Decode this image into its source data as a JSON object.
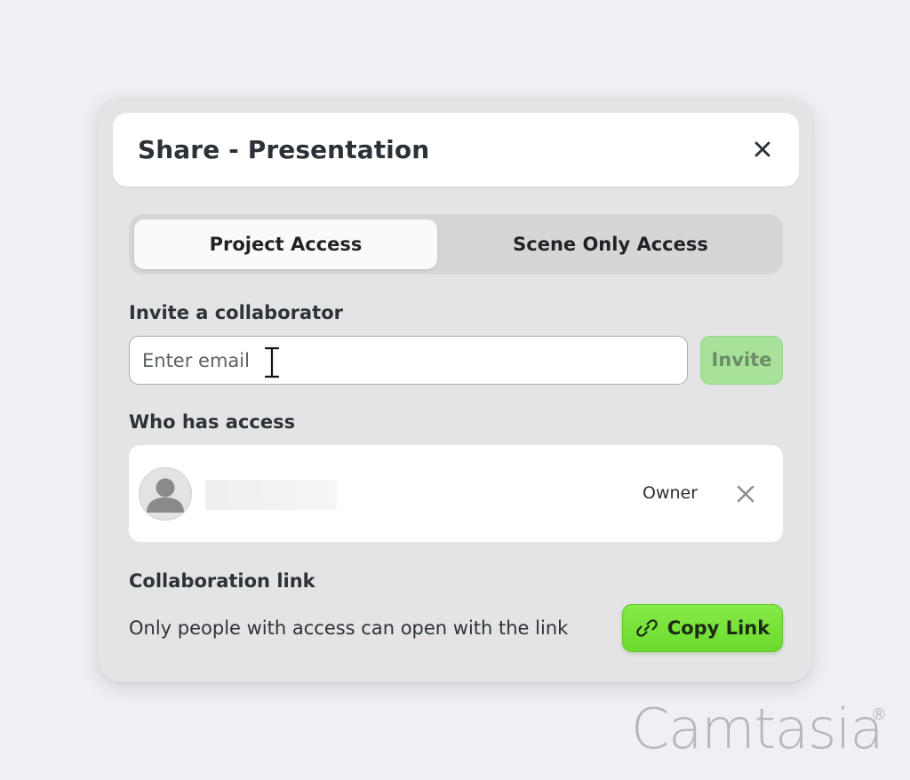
{
  "dialog": {
    "title": "Share - Presentation"
  },
  "tabs": [
    {
      "label": "Project Access",
      "active": true
    },
    {
      "label": "Scene Only Access",
      "active": false
    }
  ],
  "invite": {
    "section_label": "Invite a collaborator",
    "placeholder": "Enter email",
    "value": "",
    "button_label": "Invite",
    "button_enabled": false
  },
  "access": {
    "section_label": "Who has access",
    "members": [
      {
        "role": "Owner"
      }
    ]
  },
  "collab_link": {
    "section_label": "Collaboration link",
    "description": "Only people with access can open with the link",
    "button_label": "Copy Link"
  },
  "icons": {
    "close": "close-icon",
    "avatar": "user-avatar-icon",
    "remove": "remove-icon",
    "link": "link-icon",
    "cursor": "text-cursor-icon"
  },
  "colors": {
    "accent_green": "#6bdb2d",
    "invite_disabled": "#a8e29a",
    "dialog_bg": "#e4e4e6",
    "page_bg": "#eff0f4"
  },
  "watermark": {
    "text": "Camtasia",
    "mark": "®"
  }
}
